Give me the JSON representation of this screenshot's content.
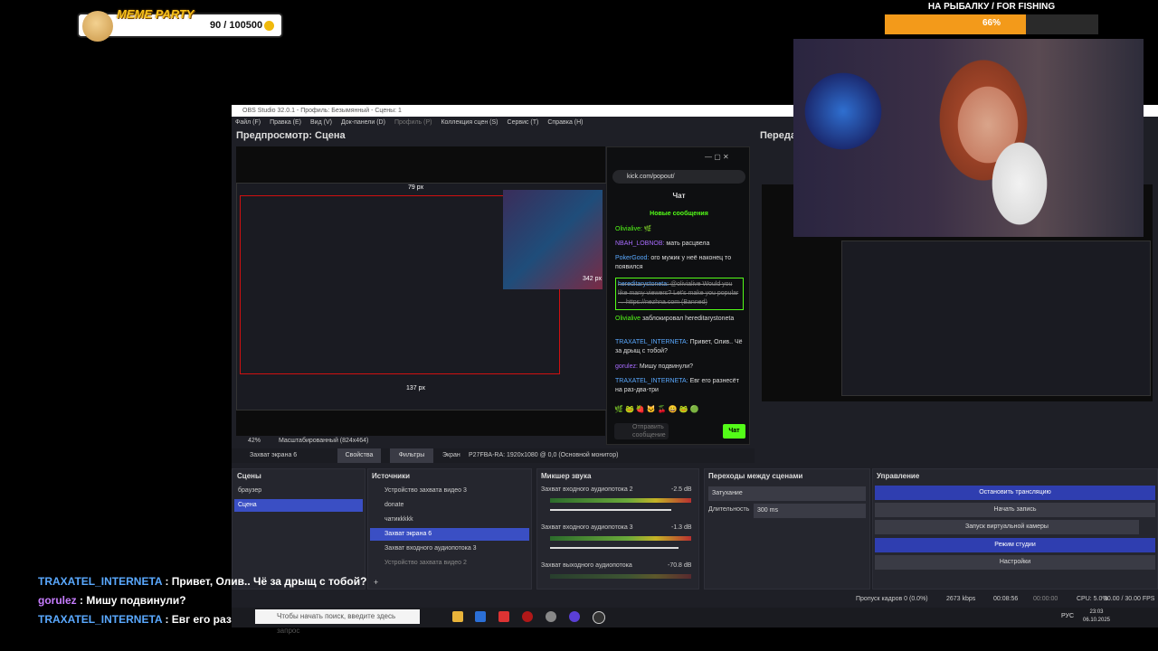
{
  "meme": {
    "title": "MEME PARTY",
    "count": "90 / 100500"
  },
  "goal": {
    "title": "НА РЫБАЛКУ / FOR FISHING",
    "percent_label": "66%",
    "progress": 0.66
  },
  "obs": {
    "title": "OBS Studio 32.0.1 - Профиль: Безымянный - Сцены: 1",
    "menu": [
      "Файл (F)",
      "Правка (E)",
      "Вид (V)",
      "Док-панели (D)",
      "Профиль (P)",
      "Коллекция сцен (S)",
      "Сервис (T)",
      "Справка (H)"
    ],
    "preview_label": "Предпросмотр: Сцена",
    "program_label": "Переда",
    "guide_top": "79 px",
    "guide_right": "342 px",
    "guide_bottom": "137 px",
    "zoom": "42%",
    "scale_mode": "Масштабированный (824x464)",
    "source_bar": {
      "name": "Захват экрана 6",
      "props": "Свойства",
      "filters": "Фильтры",
      "screen_label": "Экран",
      "screen_value": "P27FBA-RA: 1920x1080 @ 0,0 (Основной монитор)"
    },
    "scenes": {
      "header": "Сцены",
      "items": [
        "браузер",
        "Сцена"
      ],
      "selected": 1
    },
    "sources": {
      "header": "Источники",
      "items": [
        "Устройство захвата видео 3",
        "donate",
        "чатикkkkk",
        "Захват экрана 6",
        "Захват входного аудиопотока 3",
        "Устройство захвата видео 2"
      ],
      "selected": 3
    },
    "mixer": {
      "header": "Микшер звука",
      "tracks": [
        {
          "name": "Захват входного аудиопотока 2",
          "db": "-2.5 dB"
        },
        {
          "name": "Захват входного аудиопотока 3",
          "db": "-1.3 dB"
        },
        {
          "name": "Захват выходного аудиопотока",
          "db": "-70.8 dB"
        }
      ]
    },
    "transitions": {
      "header": "Переходы между сценами",
      "type": "Затухание",
      "duration_label": "Длительность",
      "duration_value": "300 ms"
    },
    "controls": {
      "header": "Управление",
      "stop_stream": "Остановить трансляцию",
      "start_record": "Начать запись",
      "virtual_cam": "Запуск виртуальной камеры",
      "studio_mode": "Режим студии",
      "settings": "Настройки"
    },
    "status": {
      "dropped": "Пропуск кадров 0 (0.0%)",
      "bitrate": "2673 kbps",
      "stream_time": "00:08:56",
      "rec_time": "00:00:00",
      "cpu": "CPU: 5.0%",
      "fps": "30.00 / 30.00 FPS"
    }
  },
  "chat_popup": {
    "url": "kick.com/popout/",
    "title": "Чат",
    "new_messages": "Новые сообщения",
    "messages": [
      {
        "user": "Olivialive:",
        "text": "🌿"
      },
      {
        "user": "NBAH_LOBNOB:",
        "text": "мать расцвела"
      },
      {
        "user": "PokerGood:",
        "text": "ого мужик у неё наконец то появился"
      },
      {
        "user": "hereditarystoneta:",
        "text": "@olivialive Would you like many viewers? Let's make you popular → https://nezhna.com (Banned)"
      },
      {
        "user": "Olivialive",
        "text": "заблокировал hereditarystoneta"
      },
      {
        "user": "TRAXATEL_INTERNETA:",
        "text": "Привет, Олив.. Чё за дрыщ с тобой?"
      },
      {
        "user": "gorulez:",
        "text": "Мишу подвинули?"
      },
      {
        "user": "TRAXATEL_INTERNETA:",
        "text": "Евг его разнесёт на раз-два-три"
      }
    ],
    "input_placeholder": "Отправить сообщение",
    "send_label": "Чат"
  },
  "overlay_chat": [
    {
      "user": "TRAXATEL_INTERNETA",
      "text": ": Привет, Олив.. Чё за дрыщ с тобой?"
    },
    {
      "user": "gorulez",
      "text": ": Мишу подвинули?"
    },
    {
      "user": "TRAXATEL_INTERNETA",
      "text": ": Евг его разнесёт на раз-два-три"
    }
  ],
  "taskbar": {
    "search_placeholder": "Чтобы начать поиск, введите здесь запрос",
    "lang": "РУС",
    "time": "23:03",
    "date": "06.10.2025"
  }
}
